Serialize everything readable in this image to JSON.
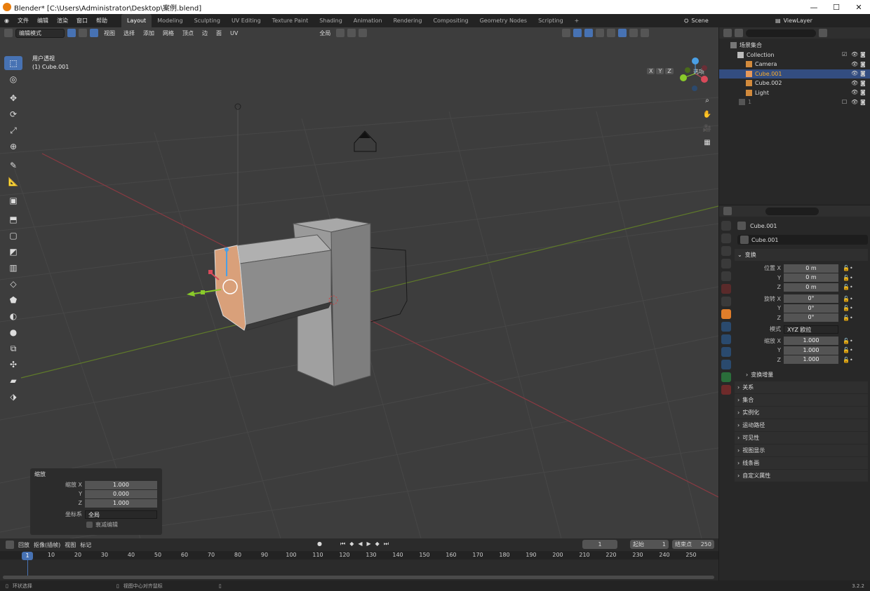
{
  "window": {
    "title": "Blender* [C:\\Users\\Administrator\\Desktop\\案例.blend]",
    "controls": [
      "—",
      "☐",
      "✕"
    ]
  },
  "menu": [
    "文件",
    "编辑",
    "渲染",
    "窗口",
    "帮助"
  ],
  "workspaces": [
    {
      "label": "Layout",
      "active": true
    },
    {
      "label": "Modeling"
    },
    {
      "label": "Sculpting"
    },
    {
      "label": "UV Editing"
    },
    {
      "label": "Texture Paint"
    },
    {
      "label": "Shading"
    },
    {
      "label": "Animation"
    },
    {
      "label": "Rendering"
    },
    {
      "label": "Compositing"
    },
    {
      "label": "Geometry Nodes"
    },
    {
      "label": "Scripting"
    }
  ],
  "add_workspace": "+",
  "scene": "Scene",
  "view_layer": "ViewLayer",
  "viewport": {
    "mode": "编辑模式",
    "menus": [
      "视图",
      "选择",
      "添加",
      "网格",
      "顶点",
      "边",
      "面",
      "UV"
    ],
    "orientation": "全局",
    "info_line1": "用户透视",
    "info_line2": "(1) Cube.001",
    "axes": [
      "X",
      "Y",
      "Z"
    ],
    "options": "选项"
  },
  "last_operator": {
    "title": "缩放",
    "rows": [
      {
        "label": "缩放 X",
        "value": "1.000"
      },
      {
        "label": "Y",
        "value": "0.000"
      },
      {
        "label": "Z",
        "value": "1.000"
      }
    ],
    "coord_label": "坐标系",
    "coord_value": "全局",
    "proportional": "衰减编辑"
  },
  "outliner": {
    "root": "场景集合",
    "items": [
      {
        "label": "Collection",
        "color": "#cccccc"
      },
      {
        "label": "Camera",
        "color": "#cccccc"
      },
      {
        "label": "Cube.001",
        "color": "#ffaf29",
        "selected": true
      },
      {
        "label": "Cube.002",
        "color": "#cccccc"
      },
      {
        "label": "Light",
        "color": "#cccccc"
      },
      {
        "label": "1",
        "color": "#777777"
      }
    ]
  },
  "properties": {
    "object_name": "Cube.001",
    "datablock": "Cube.001",
    "transform_title": "变换",
    "location": [
      {
        "label": "位置 X",
        "value": "0 m"
      },
      {
        "label": "Y",
        "value": "0 m"
      },
      {
        "label": "Z",
        "value": "0 m"
      }
    ],
    "rotation": [
      {
        "label": "旋转 X",
        "value": "0°"
      },
      {
        "label": "Y",
        "value": "0°"
      },
      {
        "label": "Z",
        "value": "0°"
      }
    ],
    "mode_label": "模式",
    "mode_value": "XYZ 欧拉",
    "scale": [
      {
        "label": "缩放 X",
        "value": "1.000"
      },
      {
        "label": "Y",
        "value": "1.000"
      },
      {
        "label": "Z",
        "value": "1.000"
      }
    ],
    "delta": "变换增量",
    "sections": [
      "关系",
      "集合",
      "实例化",
      "运动路径",
      "可见性",
      "视图显示",
      "线条画",
      "自定义属性"
    ]
  },
  "timeline": {
    "menus": [
      "回放",
      "抠像(插帧)",
      "视图",
      "标记"
    ],
    "current_frame": "1",
    "start_label": "起始",
    "start_value": "1",
    "end_label": "结束点",
    "end_value": "250",
    "ticks": [
      "10",
      "20",
      "30",
      "40",
      "50",
      "60",
      "70",
      "80",
      "90",
      "100",
      "110",
      "120",
      "130",
      "140",
      "150",
      "160",
      "170",
      "180",
      "190",
      "200",
      "210",
      "220",
      "230",
      "240",
      "250"
    ],
    "cursor": "1"
  },
  "status": {
    "left": "环状选择",
    "middle": "视图中心对齐鼠标",
    "version": "3.2.2"
  },
  "colors": {
    "accent": "#4772b3",
    "selected_text": "#ffaf29",
    "x_axis": "#d94a5a",
    "y_axis": "#8acb2a",
    "z_axis": "#4aa0e6",
    "face_sel": "#d9a07a"
  }
}
